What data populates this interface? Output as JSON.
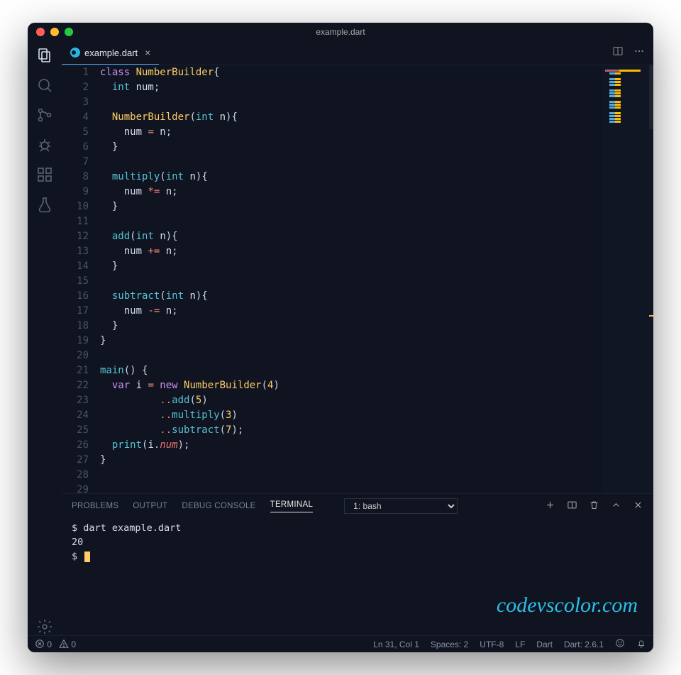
{
  "window": {
    "title": "example.dart"
  },
  "tab": {
    "filename": "example.dart"
  },
  "code_lines": [
    [
      [
        "k-class",
        "class "
      ],
      [
        "k-name",
        "NumberBuilder"
      ],
      [
        "k-punc",
        "{"
      ]
    ],
    [
      [
        "k-punc",
        "  "
      ],
      [
        "k-type",
        "int "
      ],
      [
        "k-var",
        "num"
      ],
      [
        "k-punc",
        ";"
      ]
    ],
    [
      [
        "",
        ""
      ]
    ],
    [
      [
        "k-punc",
        "  "
      ],
      [
        "k-name",
        "NumberBuilder"
      ],
      [
        "k-punc",
        "("
      ],
      [
        "k-type",
        "int "
      ],
      [
        "k-var",
        "n"
      ],
      [
        "k-punc",
        "){"
      ]
    ],
    [
      [
        "k-punc",
        "    "
      ],
      [
        "k-var",
        "num "
      ],
      [
        "k-op",
        "="
      ],
      [
        "k-var",
        " n"
      ],
      [
        "k-punc",
        ";"
      ]
    ],
    [
      [
        "k-punc",
        "  }"
      ]
    ],
    [
      [
        "",
        ""
      ]
    ],
    [
      [
        "k-punc",
        "  "
      ],
      [
        "k-func",
        "multiply"
      ],
      [
        "k-punc",
        "("
      ],
      [
        "k-type",
        "int "
      ],
      [
        "k-var",
        "n"
      ],
      [
        "k-punc",
        "){"
      ]
    ],
    [
      [
        "k-punc",
        "    "
      ],
      [
        "k-var",
        "num "
      ],
      [
        "k-op",
        "*="
      ],
      [
        "k-var",
        " n"
      ],
      [
        "k-punc",
        ";"
      ]
    ],
    [
      [
        "k-punc",
        "  }"
      ]
    ],
    [
      [
        "",
        ""
      ]
    ],
    [
      [
        "k-punc",
        "  "
      ],
      [
        "k-func",
        "add"
      ],
      [
        "k-punc",
        "("
      ],
      [
        "k-type",
        "int "
      ],
      [
        "k-var",
        "n"
      ],
      [
        "k-punc",
        "){"
      ]
    ],
    [
      [
        "k-punc",
        "    "
      ],
      [
        "k-var",
        "num "
      ],
      [
        "k-op",
        "+="
      ],
      [
        "k-var",
        " n"
      ],
      [
        "k-punc",
        ";"
      ]
    ],
    [
      [
        "k-punc",
        "  }"
      ]
    ],
    [
      [
        "",
        ""
      ]
    ],
    [
      [
        "k-punc",
        "  "
      ],
      [
        "k-func",
        "subtract"
      ],
      [
        "k-punc",
        "("
      ],
      [
        "k-type",
        "int "
      ],
      [
        "k-var",
        "n"
      ],
      [
        "k-punc",
        "){"
      ]
    ],
    [
      [
        "k-punc",
        "    "
      ],
      [
        "k-var",
        "num "
      ],
      [
        "k-op",
        "-="
      ],
      [
        "k-var",
        " n"
      ],
      [
        "k-punc",
        ";"
      ]
    ],
    [
      [
        "k-punc",
        "  }"
      ]
    ],
    [
      [
        "k-punc",
        "}"
      ]
    ],
    [
      [
        "",
        ""
      ]
    ],
    [
      [
        "k-func",
        "main"
      ],
      [
        "k-punc",
        "() {"
      ]
    ],
    [
      [
        "k-punc",
        "  "
      ],
      [
        "k-class",
        "var "
      ],
      [
        "k-var",
        "i "
      ],
      [
        "k-op",
        "="
      ],
      [
        "k-class",
        " new "
      ],
      [
        "k-name",
        "NumberBuilder"
      ],
      [
        "k-punc",
        "("
      ],
      [
        "k-num",
        "4"
      ],
      [
        "k-punc",
        ")"
      ]
    ],
    [
      [
        "k-punc",
        "          "
      ],
      [
        "k-cascade",
        ".."
      ],
      [
        "k-func",
        "add"
      ],
      [
        "k-punc",
        "("
      ],
      [
        "k-num",
        "5"
      ],
      [
        "k-punc",
        ")"
      ]
    ],
    [
      [
        "k-punc",
        "          "
      ],
      [
        "k-cascade",
        ".."
      ],
      [
        "k-func",
        "multiply"
      ],
      [
        "k-punc",
        "("
      ],
      [
        "k-num",
        "3"
      ],
      [
        "k-punc",
        ")"
      ]
    ],
    [
      [
        "k-punc",
        "          "
      ],
      [
        "k-cascade",
        ".."
      ],
      [
        "k-func",
        "subtract"
      ],
      [
        "k-punc",
        "("
      ],
      [
        "k-num",
        "7"
      ],
      [
        "k-punc",
        ");"
      ]
    ],
    [
      [
        "k-punc",
        "  "
      ],
      [
        "k-func",
        "print"
      ],
      [
        "k-punc",
        "(i."
      ],
      [
        "k-field",
        "num"
      ],
      [
        "k-punc",
        ");"
      ]
    ],
    [
      [
        "k-punc",
        "}"
      ]
    ],
    [
      [
        "",
        ""
      ]
    ],
    [
      [
        "",
        ""
      ]
    ]
  ],
  "panel": {
    "tabs": {
      "problems": "PROBLEMS",
      "output": "OUTPUT",
      "debug": "DEBUG CONSOLE",
      "terminal": "TERMINAL"
    },
    "terminal_selector": "1: bash",
    "terminal_lines": [
      "$ dart example.dart",
      "20",
      "$ "
    ]
  },
  "watermark": "codevscolor.com",
  "status": {
    "errors": "0",
    "warnings": "0",
    "cursor": "Ln 31, Col 1",
    "spaces": "Spaces: 2",
    "encoding": "UTF-8",
    "eol": "LF",
    "lang": "Dart",
    "dartver": "Dart: 2.6.1"
  }
}
